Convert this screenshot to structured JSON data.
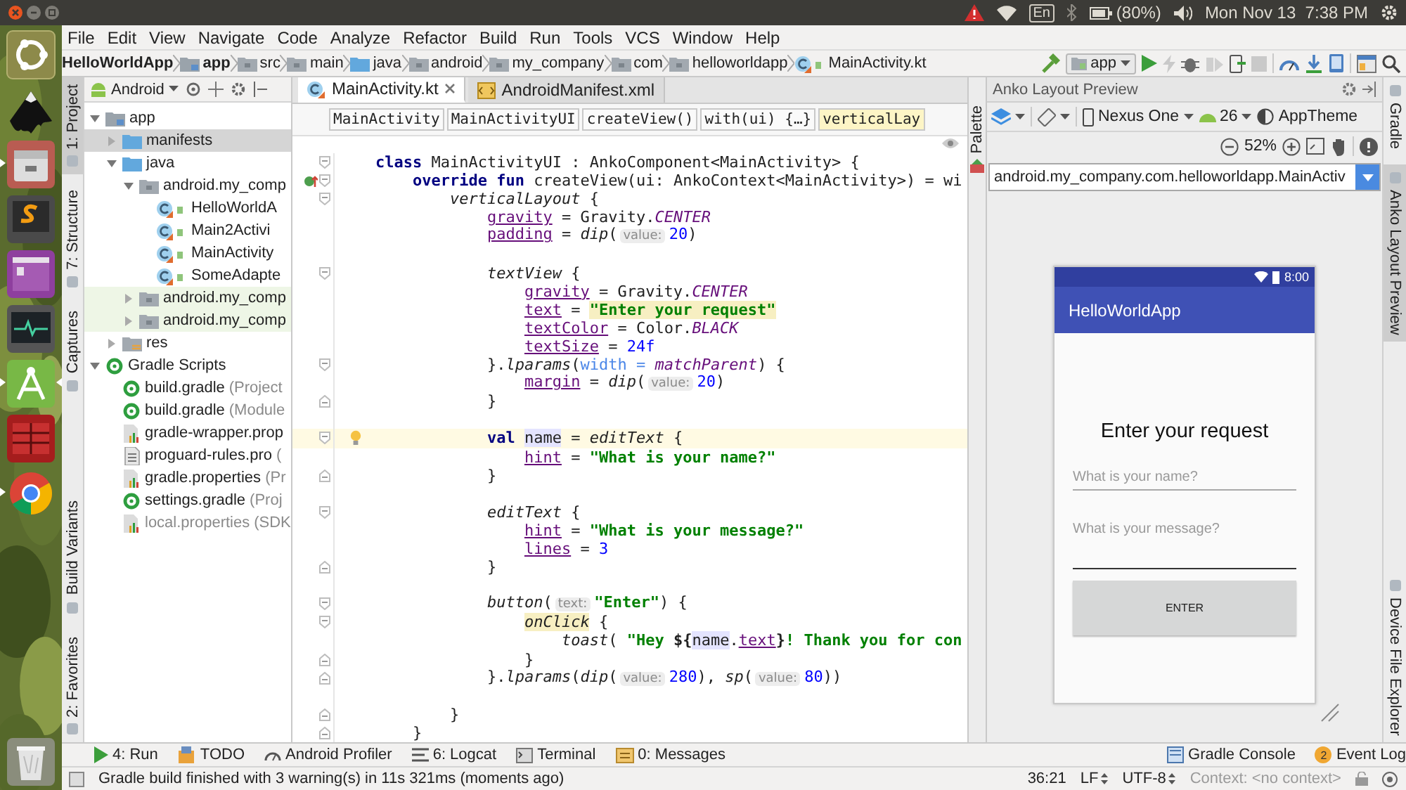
{
  "desktop_panel": {
    "keyboard": "En",
    "battery": "(80%)",
    "clock": "Mon Nov 13  7:38 PM"
  },
  "launcher": {
    "items": [
      {
        "kind": "dash",
        "running": false,
        "focused": false
      },
      {
        "kind": "vector",
        "running": false,
        "focused": false
      },
      {
        "kind": "files",
        "running": true,
        "focused": false
      },
      {
        "kind": "editor",
        "running": false,
        "focused": false
      },
      {
        "kind": "window",
        "running": false,
        "focused": false
      },
      {
        "kind": "monitor",
        "running": false,
        "focused": false
      },
      {
        "kind": "studio",
        "running": true,
        "focused": true
      },
      {
        "kind": "grid",
        "running": false,
        "focused": false
      },
      {
        "kind": "browser",
        "running": true,
        "focused": false
      },
      {
        "kind": "trash",
        "running": false,
        "focused": false
      }
    ]
  },
  "menu": [
    "File",
    "Edit",
    "View",
    "Navigate",
    "Code",
    "Analyze",
    "Refactor",
    "Build",
    "Run",
    "Tools",
    "VCS",
    "Window",
    "Help"
  ],
  "navigation": {
    "crumbs": [
      {
        "label": "HelloWorldApp",
        "bold": true
      },
      {
        "label": "app",
        "kind": "module",
        "bold": true
      },
      {
        "label": "src",
        "kind": "package",
        "bold": false
      },
      {
        "label": "main",
        "kind": "package",
        "bold": false
      },
      {
        "label": "java",
        "kind": "folder",
        "bold": false
      },
      {
        "label": "android",
        "kind": "package",
        "bold": false
      },
      {
        "label": "my_company",
        "kind": "package",
        "bold": false
      },
      {
        "label": "com",
        "kind": "package",
        "bold": false
      },
      {
        "label": "helloworldapp",
        "kind": "package",
        "bold": false
      },
      {
        "label": "MainActivity.kt",
        "kind": "kotlin-class",
        "bold": false
      }
    ],
    "run_config": "app"
  },
  "left_tools": {
    "top": [
      {
        "label": "1: Project",
        "selected": true
      },
      {
        "label": "7: Structure",
        "selected": false
      },
      {
        "label": "Captures",
        "selected": false
      }
    ],
    "bottom": [
      {
        "label": "Build Variants",
        "selected": false
      },
      {
        "label": "2: Favorites",
        "selected": false
      }
    ]
  },
  "project": {
    "view": "Android",
    "tree": [
      {
        "label": "app",
        "kind": "module",
        "expanded": true,
        "selected": false,
        "children": [
          {
            "label": "manifests",
            "kind": "folder",
            "expanded": false,
            "selected": true
          },
          {
            "label": "java",
            "kind": "folder",
            "expanded": true,
            "selected": false,
            "children": [
              {
                "label": "android.my_comp",
                "kind": "package",
                "expanded": true,
                "selected": false,
                "test": false,
                "children": [
                  {
                    "label": "HelloWorldA",
                    "kind": "kotlin-class",
                    "selected": false
                  },
                  {
                    "label": "Main2Activi",
                    "kind": "kotlin-class",
                    "selected": false
                  },
                  {
                    "label": "MainActivity",
                    "kind": "kotlin-class",
                    "selected": false
                  },
                  {
                    "label": "SomeAdapte",
                    "kind": "kotlin-class",
                    "selected": false
                  }
                ]
              },
              {
                "label": "android.my_comp",
                "kind": "package",
                "expanded": false,
                "selected": false,
                "test": true
              },
              {
                "label": "android.my_comp",
                "kind": "package",
                "expanded": false,
                "selected": false,
                "test": true
              }
            ]
          },
          {
            "label": "res",
            "kind": "res-folder",
            "expanded": false,
            "selected": false
          }
        ]
      },
      {
        "label": "Gradle Scripts",
        "kind": "gradle",
        "expanded": true,
        "selected": false,
        "children": [
          {
            "label": "build.gradle",
            "note": "(Project",
            "kind": "gradle",
            "selected": false,
            "dimmed": false
          },
          {
            "label": "build.gradle",
            "note": "(Module",
            "kind": "gradle",
            "selected": false,
            "dimmed": false
          },
          {
            "label": "gradle-wrapper.prop",
            "kind": "properties",
            "selected": false,
            "dimmed": false
          },
          {
            "label": "proguard-rules.pro",
            "note": "(",
            "kind": "text-file",
            "selected": false,
            "dimmed": false
          },
          {
            "label": "gradle.properties",
            "note": "(Pr",
            "kind": "properties",
            "selected": false,
            "dimmed": false
          },
          {
            "label": "settings.gradle",
            "note": "(Proj",
            "kind": "gradle",
            "selected": false,
            "dimmed": false
          },
          {
            "label": "local.properties",
            "note": "(SDK",
            "kind": "properties",
            "selected": false,
            "dimmed": true
          }
        ]
      }
    ]
  },
  "editor": {
    "tabs": [
      {
        "label": "MainActivity.kt",
        "kind": "kotlin",
        "selected": true
      },
      {
        "label": "AndroidManifest.xml",
        "kind": "xml",
        "selected": false
      }
    ],
    "breadcrumbs": [
      {
        "label": "MainActivity",
        "selected": false
      },
      {
        "label": "MainActivityUI",
        "selected": false
      },
      {
        "label": "createView()",
        "selected": false
      },
      {
        "label": "with(ui) {…}",
        "selected": false
      },
      {
        "label": "verticalLay",
        "selected": true
      }
    ],
    "lines": [
      {
        "kind": "open",
        "tokens": [
          {
            "kind": "kw",
            "text": "class"
          },
          {
            "kind": "plain",
            "text": " MainActivityUI : AnkoComponent<MainActivity> {"
          }
        ]
      },
      {
        "kind": "override",
        "tokens": [
          {
            "kind": "kw",
            "text": "    override fun"
          },
          {
            "kind": "plain",
            "text": " createView(ui: AnkoContext<MainActivity>) = wi"
          }
        ]
      },
      {
        "kind": "open",
        "tokens": [
          {
            "kind": "call",
            "text": "        verticalLayout"
          },
          {
            "kind": "plain",
            "text": " {"
          }
        ]
      },
      {
        "kind": "code",
        "tokens": [
          {
            "kind": "prop",
            "text": "            gravity"
          },
          {
            "kind": "plain",
            "text": " = Gravity."
          },
          {
            "kind": "const",
            "text": "CENTER"
          }
        ]
      },
      {
        "kind": "code",
        "tokens": [
          {
            "kind": "prop",
            "text": "            padding"
          },
          {
            "kind": "plain",
            "text": " = "
          },
          {
            "kind": "call",
            "text": "dip"
          },
          {
            "kind": "plain",
            "text": "("
          },
          {
            "kind": "hint",
            "text": "value:"
          },
          {
            "kind": "num",
            "text": "20"
          },
          {
            "kind": "plain",
            "text": ")"
          }
        ]
      },
      {
        "kind": "blank"
      },
      {
        "kind": "open",
        "tokens": [
          {
            "kind": "call",
            "text": "            textView"
          },
          {
            "kind": "plain",
            "text": " {"
          }
        ]
      },
      {
        "kind": "code",
        "tokens": [
          {
            "kind": "prop",
            "text": "                gravity"
          },
          {
            "kind": "plain",
            "text": " = Gravity."
          },
          {
            "kind": "const",
            "text": "CENTER"
          }
        ]
      },
      {
        "kind": "code",
        "tokens": [
          {
            "kind": "prop",
            "text": "                text"
          },
          {
            "kind": "plain",
            "text": " = "
          },
          {
            "kind": "str",
            "text": "\"Enter your request\"",
            "marked": true
          }
        ]
      },
      {
        "kind": "code",
        "tokens": [
          {
            "kind": "prop",
            "text": "                textColor"
          },
          {
            "kind": "plain",
            "text": " = Color."
          },
          {
            "kind": "const",
            "text": "BLACK"
          }
        ]
      },
      {
        "kind": "code",
        "tokens": [
          {
            "kind": "prop",
            "text": "                textSize"
          },
          {
            "kind": "plain",
            "text": " = "
          },
          {
            "kind": "num",
            "text": "24f"
          }
        ]
      },
      {
        "kind": "open",
        "tokens": [
          {
            "kind": "plain",
            "text": "            }."
          },
          {
            "kind": "call",
            "text": "lparams"
          },
          {
            "kind": "plain",
            "text": "("
          },
          {
            "kind": "arg",
            "text": "width = "
          },
          {
            "kind": "const",
            "text": "matchParent"
          },
          {
            "kind": "plain",
            "text": ") {"
          }
        ]
      },
      {
        "kind": "code",
        "tokens": [
          {
            "kind": "prop",
            "text": "                margin"
          },
          {
            "kind": "plain",
            "text": " = "
          },
          {
            "kind": "call",
            "text": "dip"
          },
          {
            "kind": "plain",
            "text": "("
          },
          {
            "kind": "hint",
            "text": "value:"
          },
          {
            "kind": "num",
            "text": "20"
          },
          {
            "kind": "plain",
            "text": ")"
          }
        ]
      },
      {
        "kind": "close",
        "tokens": [
          {
            "kind": "plain",
            "text": "            }"
          }
        ]
      },
      {
        "kind": "blank"
      },
      {
        "kind": "bulb",
        "current": true,
        "tokens": [
          {
            "kind": "kw",
            "text": "            val "
          },
          {
            "kind": "ref",
            "text": "name"
          },
          {
            "kind": "plain",
            "text": " = "
          },
          {
            "kind": "call",
            "text": "editText"
          },
          {
            "kind": "plain",
            "text": " {"
          }
        ]
      },
      {
        "kind": "code",
        "tokens": [
          {
            "kind": "prop",
            "text": "                hint"
          },
          {
            "kind": "plain",
            "text": " = "
          },
          {
            "kind": "str",
            "text": "\"What is your name?\""
          }
        ]
      },
      {
        "kind": "close",
        "tokens": [
          {
            "kind": "plain",
            "text": "            }"
          }
        ]
      },
      {
        "kind": "blank"
      },
      {
        "kind": "open",
        "tokens": [
          {
            "kind": "call",
            "text": "            editText"
          },
          {
            "kind": "plain",
            "text": " {"
          }
        ]
      },
      {
        "kind": "code",
        "tokens": [
          {
            "kind": "prop",
            "text": "                hint"
          },
          {
            "kind": "plain",
            "text": " = "
          },
          {
            "kind": "str",
            "text": "\"What is your message?\""
          }
        ]
      },
      {
        "kind": "code",
        "tokens": [
          {
            "kind": "prop",
            "text": "                lines"
          },
          {
            "kind": "plain",
            "text": " = "
          },
          {
            "kind": "num",
            "text": "3"
          }
        ]
      },
      {
        "kind": "close",
        "tokens": [
          {
            "kind": "plain",
            "text": "            }"
          }
        ]
      },
      {
        "kind": "blank"
      },
      {
        "kind": "open",
        "tokens": [
          {
            "kind": "call",
            "text": "            button"
          },
          {
            "kind": "plain",
            "text": "("
          },
          {
            "kind": "hint",
            "text": "text:"
          },
          {
            "kind": "str",
            "text": "\"Enter\""
          },
          {
            "kind": "plain",
            "text": ") {"
          }
        ]
      },
      {
        "kind": "open",
        "tokens": [
          {
            "kind": "call",
            "text": "                onClick",
            "marked": true
          },
          {
            "kind": "plain",
            "text": " {"
          }
        ]
      },
      {
        "kind": "code",
        "tokens": [
          {
            "kind": "call",
            "text": "                    toast"
          },
          {
            "kind": "plain",
            "text": "( "
          },
          {
            "kind": "str",
            "text": "\"Hey "
          },
          {
            "kind": "brace",
            "text": "${"
          },
          {
            "kind": "ref",
            "text": "name"
          },
          {
            "kind": "plain",
            "text": "."
          },
          {
            "kind": "prop",
            "text": "text"
          },
          {
            "kind": "brace",
            "text": "}"
          },
          {
            "kind": "str",
            "text": "! Thank you for con"
          }
        ]
      },
      {
        "kind": "close",
        "tokens": [
          {
            "kind": "plain",
            "text": "                }"
          }
        ]
      },
      {
        "kind": "close",
        "tokens": [
          {
            "kind": "plain",
            "text": "            }."
          },
          {
            "kind": "call",
            "text": "lparams"
          },
          {
            "kind": "plain",
            "text": "("
          },
          {
            "kind": "call",
            "text": "dip"
          },
          {
            "kind": "plain",
            "text": "("
          },
          {
            "kind": "hint",
            "text": "value:"
          },
          {
            "kind": "num",
            "text": "280"
          },
          {
            "kind": "plain",
            "text": "), "
          },
          {
            "kind": "call",
            "text": "sp"
          },
          {
            "kind": "plain",
            "text": "("
          },
          {
            "kind": "hint",
            "text": "value:"
          },
          {
            "kind": "num",
            "text": "80"
          },
          {
            "kind": "plain",
            "text": "))"
          }
        ]
      },
      {
        "kind": "blank"
      },
      {
        "kind": "close",
        "tokens": [
          {
            "kind": "plain",
            "text": "        }"
          }
        ]
      },
      {
        "kind": "close",
        "tokens": [
          {
            "kind": "plain",
            "text": "    }"
          }
        ]
      }
    ]
  },
  "palette": {
    "label": "Palette"
  },
  "preview": {
    "title": "Anko Layout Preview",
    "device": "Nexus One",
    "api": "26",
    "theme": "AppTheme",
    "zoom": "52%",
    "activity": "android.my_company.com.helloworldapp.MainActiv",
    "phone": {
      "time": "8:00",
      "app_title": "HelloWorldApp",
      "heading": "Enter your request",
      "fields": [
        {
          "placeholder": "What is your name?",
          "kind": "single"
        },
        {
          "placeholder": "What is your message?",
          "kind": "multi"
        }
      ],
      "button": "ENTER"
    }
  },
  "right_tools": {
    "top": [
      {
        "label": "Gradle",
        "selected": false
      },
      {
        "label": "Anko Layout Preview",
        "selected": true
      }
    ],
    "bottom": [
      {
        "label": "Device File Explorer",
        "selected": false
      }
    ]
  },
  "tool_tabs": {
    "left": [
      {
        "label": "4: Run",
        "kind": "run"
      },
      {
        "label": "TODO",
        "kind": "todo"
      },
      {
        "label": "Android Profiler",
        "kind": "profiler"
      },
      {
        "label": "6: Logcat",
        "kind": "logcat"
      },
      {
        "label": "Terminal",
        "kind": "terminal"
      },
      {
        "label": "0: Messages",
        "kind": "messages"
      }
    ],
    "right": [
      {
        "label": "Gradle Console",
        "kind": "console"
      },
      {
        "label": "Event Log",
        "kind": "badge",
        "badge": "2"
      }
    ]
  },
  "status": {
    "message": "Gradle build finished with 3 warning(s) in 11s 321ms (moments ago)",
    "position": "36:21",
    "line_ending": "LF",
    "encoding": "UTF-8",
    "context": "Context: <no context>"
  }
}
